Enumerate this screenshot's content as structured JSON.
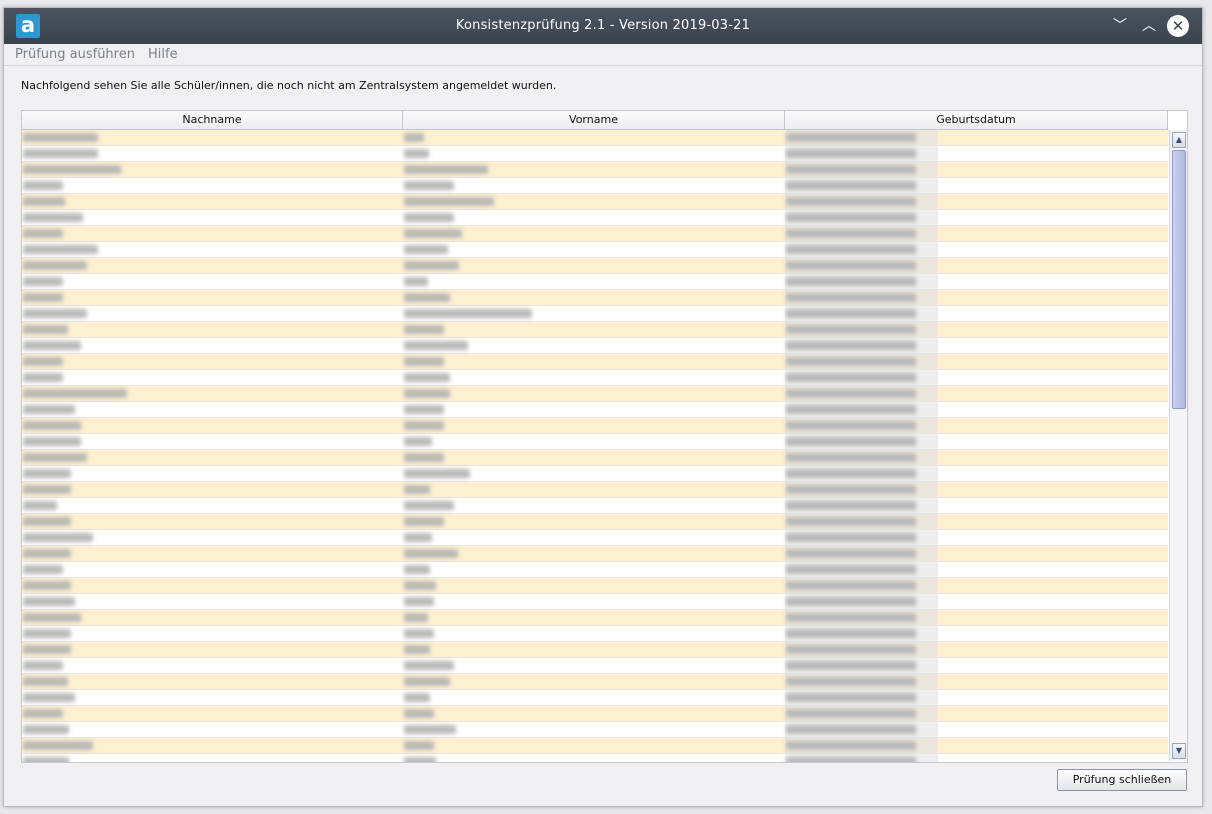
{
  "window": {
    "logo": "a",
    "title": "Konsistenzprüfung 2.1 - Version 2019-03-21",
    "controls": {
      "minimize": "﹀",
      "maximize": "︿",
      "close": "✕"
    }
  },
  "menu": {
    "items": [
      "Prüfung ausführen",
      "Hilfe"
    ]
  },
  "intro": "Nachfolgend sehen Sie alle Schüler/innen, die noch nicht am Zentralsystem angemeldet wurden.",
  "table": {
    "columns": [
      "Nachname",
      "Vorname",
      "Geburtsdatum"
    ],
    "rows_visible": 40,
    "cell_content": "blurred (unreadable)"
  },
  "scrollbar": {
    "up_arrow": "▲",
    "down_arrow": "▼"
  },
  "buttons": {
    "close_check": "Prüfung schließen"
  },
  "colors": {
    "titlebar": "#3f4852",
    "row_alternate": "#fcf0cf",
    "logo": "#2f97cf"
  }
}
